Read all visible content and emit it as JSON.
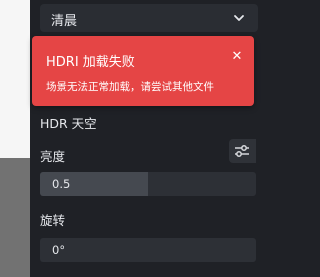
{
  "environment": {
    "preset_select": {
      "value": "清晨"
    },
    "error_toast": {
      "title": "HDRI 加载失败",
      "message": "场景无法正常加载，请尝试其他文件"
    },
    "hdr_sky": {
      "section_title": "HDR 天空",
      "brightness": {
        "label": "亮度",
        "value": "0.5",
        "level_fraction": 0.5
      },
      "rotation": {
        "label": "旋转",
        "value": "0°",
        "level_fraction": 0.0
      }
    }
  }
}
